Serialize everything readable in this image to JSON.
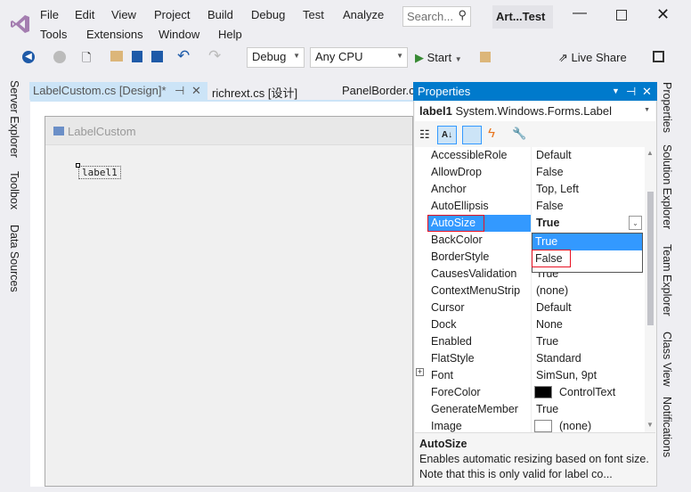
{
  "title": "Art...Test",
  "search_placeholder": "Search...",
  "menu": [
    "File",
    "Edit",
    "View",
    "Project",
    "Build",
    "Debug",
    "Test",
    "Analyze",
    "Tools",
    "Extensions",
    "Window",
    "Help"
  ],
  "toolbar": {
    "config": "Debug",
    "platform": "Any CPU",
    "start": "Start",
    "live_share": "Live Share"
  },
  "tabs": [
    "LabelCustom.cs [Design]*",
    "richrext.cs [设计]",
    "PanelBorder.cs"
  ],
  "left_strip": [
    "Server Explorer",
    "Toolbox",
    "Data Sources"
  ],
  "right_strip": [
    "Properties",
    "Solution Explorer",
    "Team Explorer",
    "Class View",
    "Notifications"
  ],
  "designer": {
    "form_title": "LabelCustom",
    "label": "label1"
  },
  "properties": {
    "title": "Properties",
    "object_name": "label1",
    "object_type": "System.Windows.Forms.Label",
    "rows": [
      {
        "name": "AccessibleRole",
        "value": "Default"
      },
      {
        "name": "AllowDrop",
        "value": "False"
      },
      {
        "name": "Anchor",
        "value": "Top, Left"
      },
      {
        "name": "AutoEllipsis",
        "value": "False"
      },
      {
        "name": "AutoSize",
        "value": "True"
      },
      {
        "name": "BackColor",
        "value": ""
      },
      {
        "name": "BorderStyle",
        "value": ""
      },
      {
        "name": "CausesValidation",
        "value": "True"
      },
      {
        "name": "ContextMenuStrip",
        "value": "(none)"
      },
      {
        "name": "Cursor",
        "value": "Default"
      },
      {
        "name": "Dock",
        "value": "None"
      },
      {
        "name": "Enabled",
        "value": "True"
      },
      {
        "name": "FlatStyle",
        "value": "Standard"
      },
      {
        "name": "Font",
        "value": "SimSun, 9pt"
      },
      {
        "name": "ForeColor",
        "value": "ControlText"
      },
      {
        "name": "GenerateMember",
        "value": "True"
      },
      {
        "name": "Image",
        "value": "(none)"
      }
    ],
    "dropdown_options": [
      "True",
      "False"
    ],
    "selected_row": "AutoSize",
    "description_title": "AutoSize",
    "description_text": "Enables automatic resizing based on font size. Note that this is only valid for label co..."
  },
  "colors": {
    "accent": "#007acc",
    "highlight": "#3399ff",
    "annotation": "#e81123"
  }
}
